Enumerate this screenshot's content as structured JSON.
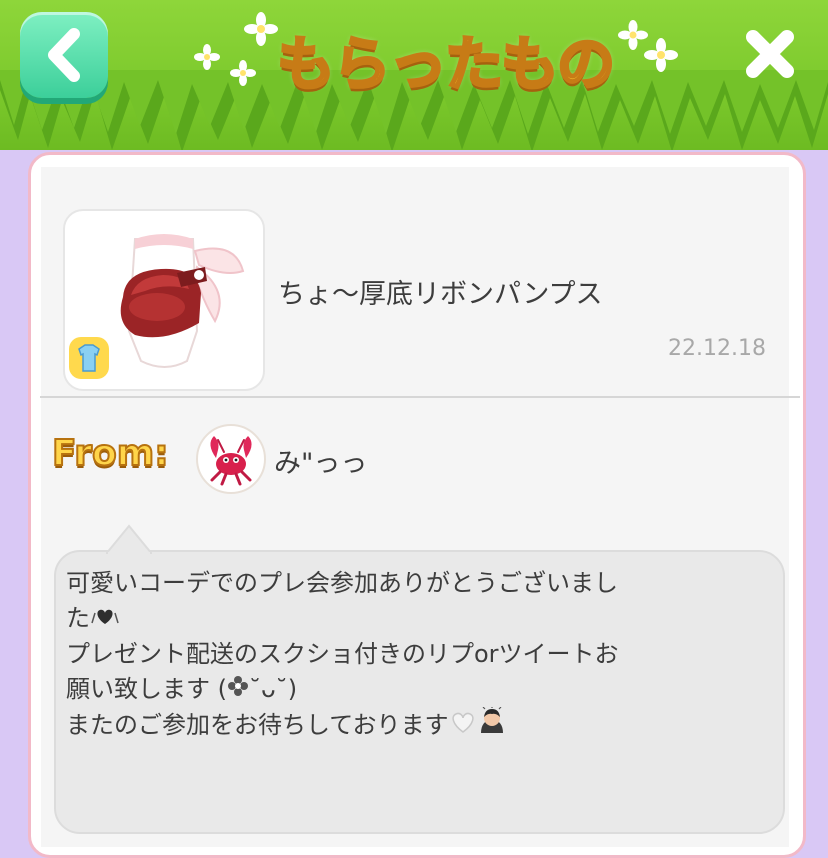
{
  "header": {
    "title": "もらったもの",
    "back_icon": "chevron-left-icon",
    "close_icon": "close-icon"
  },
  "item": {
    "name": "ちょ〜厚底リボンパンプス",
    "date": "22.12.18",
    "category_icon": "shirt-icon"
  },
  "sender": {
    "from_label": "From:",
    "name": "み\"っっ",
    "avatar_icon": "lobster-icon"
  },
  "message": {
    "lines": [
      "可愛いコーデでのプレ会参加ありがとうございまし",
      "た",
      "プレゼント配送のスクショ付きのリプorツイートお",
      "願い致します (",
      "またのご参加をお待ちしております"
    ],
    "kaomoji_face": "˘ᴗ˘"
  },
  "colors": {
    "header_green": "#7cc92c",
    "background_lavender": "#d9c8f5",
    "panel_border_pink": "#f2b9c8",
    "title_yellow": "#ffcc33",
    "back_button_mint": "#3ccf9a"
  }
}
